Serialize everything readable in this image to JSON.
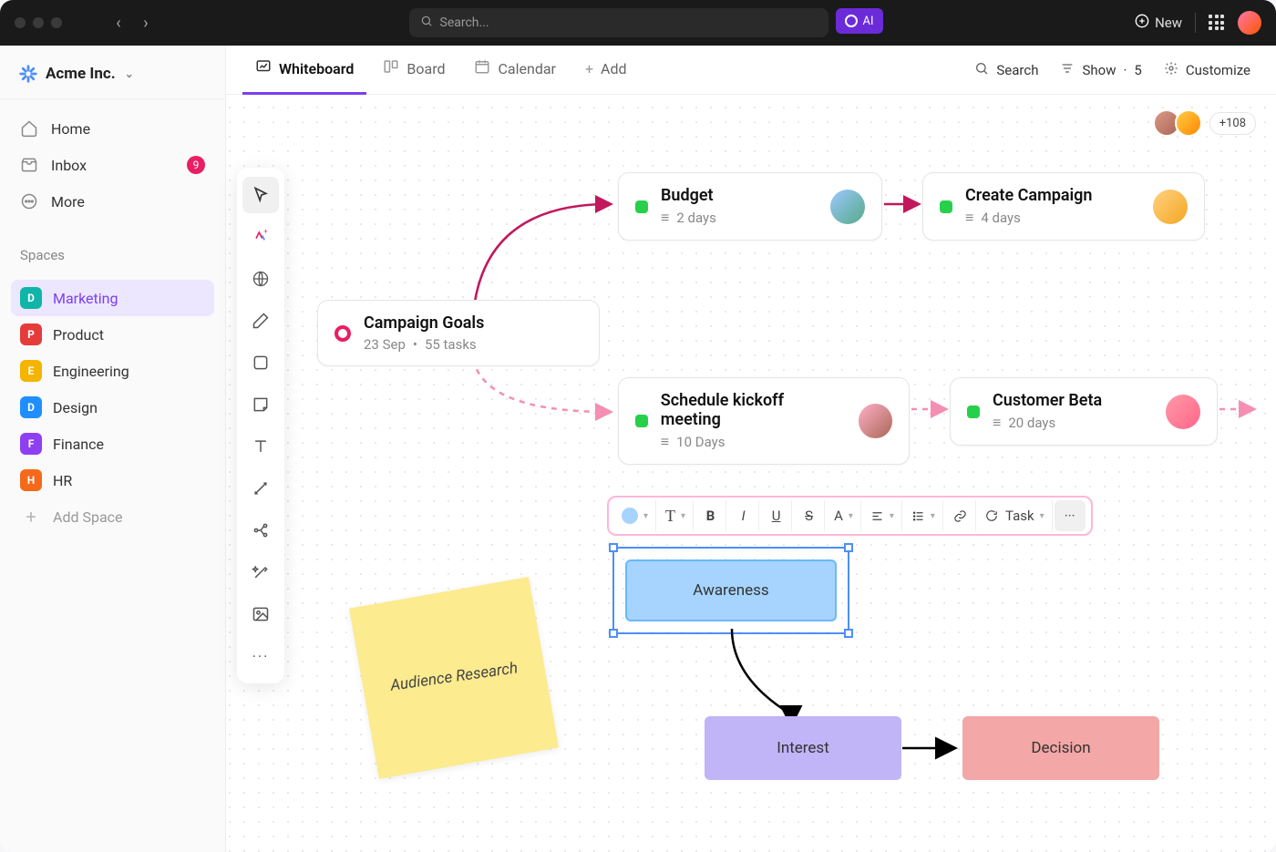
{
  "titlebar": {
    "search_placeholder": "Search...",
    "ai_label": "AI",
    "new_label": "New"
  },
  "workspace": {
    "name": "Acme Inc."
  },
  "nav": {
    "home": "Home",
    "inbox": "Inbox",
    "inbox_count": "9",
    "more": "More"
  },
  "spaces": {
    "label": "Spaces",
    "items": [
      {
        "letter": "D",
        "label": "Marketing",
        "color": "#0fb5a8"
      },
      {
        "letter": "P",
        "label": "Product",
        "color": "#e63b3b"
      },
      {
        "letter": "E",
        "label": "Engineering",
        "color": "#f5b400"
      },
      {
        "letter": "D",
        "label": "Design",
        "color": "#1f8fff"
      },
      {
        "letter": "F",
        "label": "Finance",
        "color": "#8f3ff2"
      },
      {
        "letter": "H",
        "label": "HR",
        "color": "#f46a1a"
      }
    ],
    "add_label": "Add Space"
  },
  "tabs": {
    "whiteboard": "Whiteboard",
    "board": "Board",
    "calendar": "Calendar",
    "add": "Add"
  },
  "tabactions": {
    "search": "Search",
    "show": "Show",
    "show_count": "5",
    "customize": "Customize"
  },
  "presence": {
    "count": "+108"
  },
  "cards": {
    "goals": {
      "title": "Campaign Goals",
      "date": "23 Sep",
      "tasks": "55 tasks"
    },
    "budget": {
      "title": "Budget",
      "duration": "2 days"
    },
    "create": {
      "title": "Create Campaign",
      "duration": "4 days"
    },
    "kickoff": {
      "title": "Schedule kickoff meeting",
      "duration": "10 Days"
    },
    "beta": {
      "title": "Customer Beta",
      "duration": "20 days"
    }
  },
  "sticky": {
    "text": "Audience Research"
  },
  "shapes": {
    "awareness": "Awareness",
    "interest": "Interest",
    "decision": "Decision"
  },
  "formatbar": {
    "task": "Task"
  }
}
